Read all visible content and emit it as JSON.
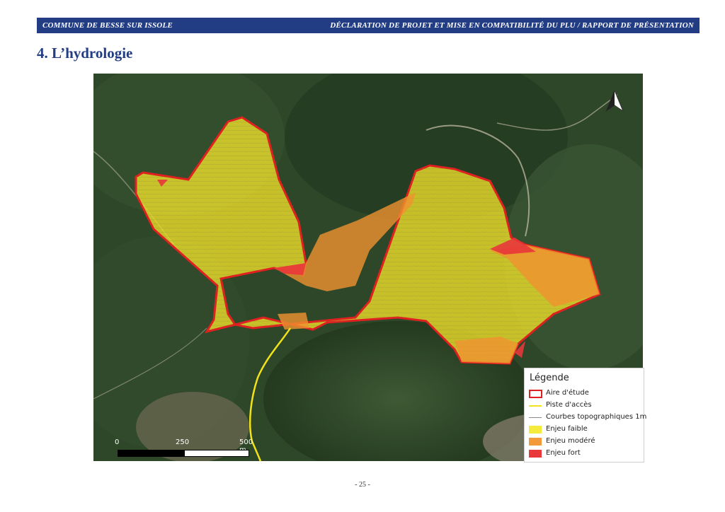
{
  "header": {
    "left": "COMMUNE DE BESSE SUR ISSOLE",
    "right": "DÉCLARATION DE PROJET ET MISE EN COMPATIBILITÉ DU PLU /  RAPPORT DE PRÉSENTATION"
  },
  "section_title": "4. L’hydrologie",
  "map": {
    "legend": {
      "title": "Légende",
      "items": [
        {
          "label": "Aire d'étude",
          "color": "#e02020",
          "style": "outline"
        },
        {
          "label": "Piste d'accès",
          "color": "#f2e21a",
          "style": "line"
        },
        {
          "label": "Courbes topographiques 1m",
          "color": "#8a8a8a",
          "style": "thin-line"
        },
        {
          "label": "Enjeu faible",
          "color": "#f5eb3c",
          "style": "fill"
        },
        {
          "label": "Enjeu modéré",
          "color": "#f29a3a",
          "style": "fill"
        },
        {
          "label": "Enjeu fort",
          "color": "#e8383a",
          "style": "fill"
        }
      ]
    },
    "scale": {
      "labels": [
        "0",
        "250",
        "500 m"
      ]
    },
    "north_arrow_icon": "north-arrow-icon"
  },
  "page_number": "- 25 -"
}
